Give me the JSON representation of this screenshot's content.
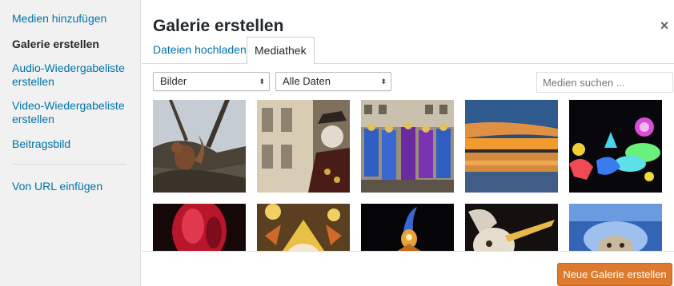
{
  "sidebar": {
    "items": [
      {
        "label": "Medien hinzufügen"
      },
      {
        "label": "Galerie erstellen"
      },
      {
        "label": "Audio-Wiedergabeliste erstellen"
      },
      {
        "label": "Video-Wiedergabeliste erstellen"
      },
      {
        "label": "Beitragsbild"
      },
      {
        "label": "Von URL einfügen"
      }
    ],
    "active_index": 1
  },
  "modal": {
    "title": "Galerie erstellen",
    "close_icon": "close-icon",
    "close_glyph": "×"
  },
  "tabs": [
    {
      "label": "Dateien hochladen",
      "selected": false
    },
    {
      "label": "Mediathek",
      "selected": true
    }
  ],
  "filters": {
    "type_selected": "Bilder",
    "date_selected": "Alle Daten",
    "arrow_glyph": "⬍"
  },
  "search": {
    "value": "",
    "placeholder": "Medien suchen ..."
  },
  "footer": {
    "primary_button_label": "Neue Galerie erstellen"
  },
  "colors": {
    "link": "#0073aa",
    "primary_button": "#dd7a2e",
    "sidebar_bg": "#f1f1f1"
  },
  "thumbnails": [
    {
      "subject": "squirrel on branch"
    },
    {
      "subject": "carnival figure with facade"
    },
    {
      "subject": "carnival parade crowd"
    },
    {
      "subject": "sunset over water"
    },
    {
      "subject": "glowing lantern figures at night"
    },
    {
      "subject": "red lantern"
    },
    {
      "subject": "golden carnival mask"
    },
    {
      "subject": "lit figure on dark background"
    },
    {
      "subject": "white mask with plume"
    },
    {
      "subject": "blue costume mask"
    }
  ]
}
